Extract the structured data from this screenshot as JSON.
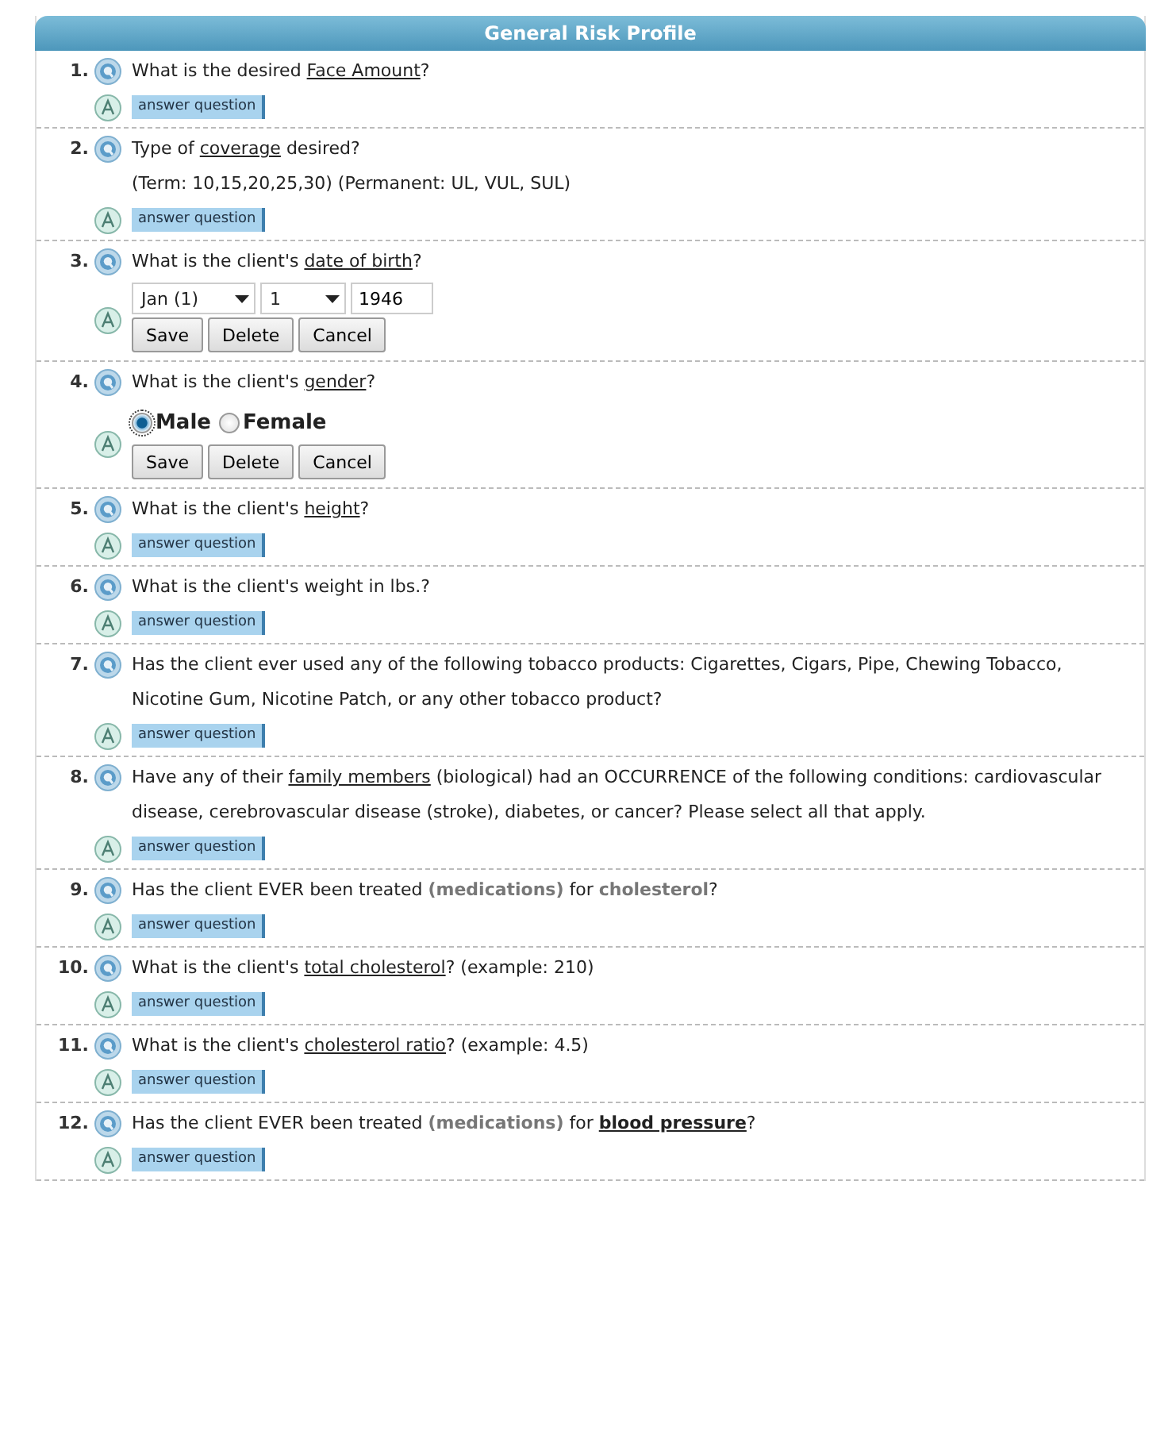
{
  "panel": {
    "title": "General Risk Profile"
  },
  "questions": [
    {
      "number": "1.",
      "parts": [
        {
          "kind": "plain",
          "text": "What is the desired "
        },
        {
          "kind": "link",
          "text": "Face Amount"
        },
        {
          "kind": "plain",
          "text": "?"
        }
      ],
      "answer": {
        "kind": "button",
        "label": "answer question"
      }
    },
    {
      "number": "2.",
      "parts": [
        {
          "kind": "plain",
          "text": "Type of "
        },
        {
          "kind": "link",
          "text": "coverage"
        },
        {
          "kind": "plain",
          "text": " desired?"
        }
      ],
      "note": "(Term: 10,15,20,25,30) (Permanent: UL, VUL, SUL)",
      "answer": {
        "kind": "button",
        "label": "answer question"
      }
    },
    {
      "number": "3.",
      "parts": [
        {
          "kind": "plain",
          "text": "What is the client's "
        },
        {
          "kind": "link",
          "text": "date of birth"
        },
        {
          "kind": "plain",
          "text": "?"
        }
      ],
      "answer": {
        "kind": "date",
        "month": "Jan (1)",
        "day": "1",
        "year": "1946",
        "buttons": [
          "Save",
          "Delete",
          "Cancel"
        ]
      }
    },
    {
      "number": "4.",
      "parts": [
        {
          "kind": "plain",
          "text": "What is the client's "
        },
        {
          "kind": "link",
          "text": "gender"
        },
        {
          "kind": "plain",
          "text": "?"
        }
      ],
      "answer": {
        "kind": "radio",
        "options": [
          {
            "label": "Male",
            "selected": true
          },
          {
            "label": "Female",
            "selected": false
          }
        ],
        "buttons": [
          "Save",
          "Delete",
          "Cancel"
        ]
      }
    },
    {
      "number": "5.",
      "parts": [
        {
          "kind": "plain",
          "text": "What is the client's "
        },
        {
          "kind": "link",
          "text": "height"
        },
        {
          "kind": "plain",
          "text": "?"
        }
      ],
      "answer": {
        "kind": "button",
        "label": "answer question"
      }
    },
    {
      "number": "6.",
      "parts": [
        {
          "kind": "plain",
          "text": "What is the client's weight in lbs.?"
        }
      ],
      "answer": {
        "kind": "button",
        "label": "answer question"
      }
    },
    {
      "number": "7.",
      "parts": [
        {
          "kind": "plain",
          "text": "Has the client ever used any of the following tobacco products: Cigarettes, Cigars, Pipe, Chewing Tobacco, Nicotine Gum, Nicotine Patch, or any other tobacco product?"
        }
      ],
      "answer": {
        "kind": "button",
        "label": "answer question"
      }
    },
    {
      "number": "8.",
      "parts": [
        {
          "kind": "plain",
          "text": "Have any of their "
        },
        {
          "kind": "link",
          "text": "family members"
        },
        {
          "kind": "plain",
          "text": " (biological) had an OCCURRENCE of the following conditions: cardiovascular disease, cerebrovascular disease (stroke), diabetes, or cancer? Please select all that apply."
        }
      ],
      "answer": {
        "kind": "button",
        "label": "answer question"
      }
    },
    {
      "number": "9.",
      "parts": [
        {
          "kind": "plain",
          "text": "Has the client EVER been treated "
        },
        {
          "kind": "muted",
          "text": "(medications)"
        },
        {
          "kind": "plain",
          "text": " for "
        },
        {
          "kind": "muted",
          "text": "cholesterol"
        },
        {
          "kind": "plain",
          "text": "?"
        }
      ],
      "answer": {
        "kind": "button",
        "label": "answer question"
      }
    },
    {
      "number": "10.",
      "parts": [
        {
          "kind": "plain",
          "text": "What is the client's "
        },
        {
          "kind": "link",
          "text": "total cholesterol"
        },
        {
          "kind": "plain",
          "text": "? (example: 210)"
        }
      ],
      "answer": {
        "kind": "button",
        "label": "answer question"
      }
    },
    {
      "number": "11.",
      "parts": [
        {
          "kind": "plain",
          "text": "What is the client's "
        },
        {
          "kind": "link",
          "text": "cholesterol ratio"
        },
        {
          "kind": "plain",
          "text": "? (example: 4.5)"
        }
      ],
      "answer": {
        "kind": "button",
        "label": "answer question"
      }
    },
    {
      "number": "12.",
      "parts": [
        {
          "kind": "plain",
          "text": "Has the client EVER been treated "
        },
        {
          "kind": "muted",
          "text": "(medications)"
        },
        {
          "kind": "plain",
          "text": " for "
        },
        {
          "kind": "boldlink",
          "text": "blood pressure"
        },
        {
          "kind": "plain",
          "text": "?"
        }
      ],
      "answer": {
        "kind": "button",
        "label": "answer question"
      }
    }
  ]
}
